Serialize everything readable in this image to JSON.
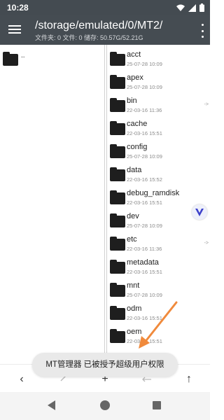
{
  "status_bar": {
    "time": "10:28"
  },
  "toolbar": {
    "path": "/storage/emulated/0/MT2/",
    "info": "文件夹: 0  文件: 0  储存: 50.57G/52.21G"
  },
  "left_pane": {
    "parent_label": ".."
  },
  "right_pane": {
    "items": [
      {
        "name": "acct",
        "date": "25-07-28 10:09",
        "link_arrow": ""
      },
      {
        "name": "apex",
        "date": "25-07-28 10:09",
        "link_arrow": ""
      },
      {
        "name": "bin",
        "date": "22-03-16 11:36",
        "link_arrow": "->"
      },
      {
        "name": "cache",
        "date": "22-03-16 15:51",
        "link_arrow": ""
      },
      {
        "name": "config",
        "date": "25-07-28 10:09",
        "link_arrow": ""
      },
      {
        "name": "data",
        "date": "22-03-16 15:52",
        "link_arrow": ""
      },
      {
        "name": "debug_ramdisk",
        "date": "22-03-16 15:51",
        "link_arrow": ""
      },
      {
        "name": "dev",
        "date": "25-07-28 10:09",
        "link_arrow": ""
      },
      {
        "name": "etc",
        "date": "22-03-16 11:36",
        "link_arrow": "->"
      },
      {
        "name": "metadata",
        "date": "22-03-16 15:51",
        "link_arrow": ""
      },
      {
        "name": "mnt",
        "date": "25-07-28 10:09",
        "link_arrow": ""
      },
      {
        "name": "odm",
        "date": "22-03-16 15:51",
        "link_arrow": ""
      },
      {
        "name": "oem",
        "date": "22-03-16 15:51",
        "link_arrow": ""
      }
    ]
  },
  "toast": {
    "message": "MT管理器 已被授予超级用户权限"
  },
  "bottom_bar": {
    "back_glyph": "‹",
    "refresh_glyph": "+",
    "up_glyph": "↑"
  },
  "colors": {
    "toolbar_bg": "#454c52",
    "status_bg": "#444b51",
    "annotation": "#f08a3c"
  }
}
